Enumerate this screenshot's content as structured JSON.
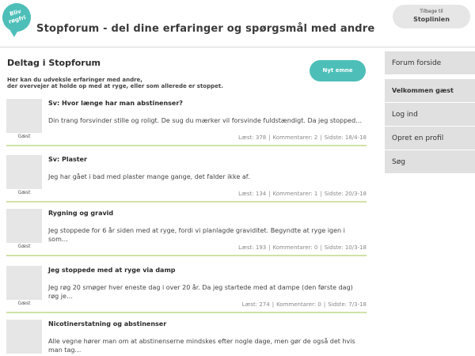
{
  "header": {
    "logo_text": "Bliv røgfri",
    "title": "Stopforum - del dine erfaringer og spørgsmål med andre",
    "back_line1": "Tilbage til",
    "back_line2": "Stoplinien"
  },
  "main": {
    "heading": "Deltag i Stopforum",
    "intro_line1": "Her kan du udveksle erfaringer med andre,",
    "intro_line2": "der overvejer at holde op med at ryge, eller som allerede er stoppet.",
    "new_topic_label": "Nyt emne"
  },
  "sidebar": {
    "items": [
      {
        "label": "Forum forside"
      },
      {
        "label": "Velkommen gæst"
      },
      {
        "label": "Log ind"
      },
      {
        "label": "Opret en profil"
      },
      {
        "label": "Søg"
      }
    ]
  },
  "posts": [
    {
      "author": "Gæst",
      "title": "Sv: Hvor længe har man abstinenser?",
      "body": "Din trang forsvinder stille og roligt. De sug du mærker vil forsvinde fuldstændigt. Da jeg stopped…",
      "read": "Læst: 378",
      "comments": "Kommentarer: 2",
      "last": "Sidste: 18/4-18"
    },
    {
      "author": "Gæst",
      "title": "Sv: Plaster",
      "body": "Jeg har gået i bad med plaster mange gange, det falder ikke af.",
      "read": "Læst: 134",
      "comments": "Kommentarer: 1",
      "last": "Sidste: 20/3-18"
    },
    {
      "author": "Gæst",
      "title": "Rygning og gravid",
      "body": "Jeg stoppede for 6 år siden med at ryge, fordi vi planlagde graviditet. Begyndte at ryge igen i som…",
      "read": "Læst: 193",
      "comments": "Kommentarer: 0",
      "last": "Sidste: 10/3-18"
    },
    {
      "author": "Gæst",
      "title": "Jeg stoppede med at ryge via damp",
      "body": "Jeg røg 20 smøger hver eneste dag i over 20 år. Da jeg startede med at dampe (den første dag) røg je…",
      "read": "Læst: 274",
      "comments": "Kommentarer: 0",
      "last": "Sidste: 7/3-18"
    },
    {
      "author": "",
      "title": "Nicotinerstatning og abstinenser",
      "body": "Alle vegne hører man om at abstinenserne mindskes efter nogle dage, men gør de også det hvis man tag…",
      "read": "",
      "comments": "",
      "last": ""
    }
  ]
}
